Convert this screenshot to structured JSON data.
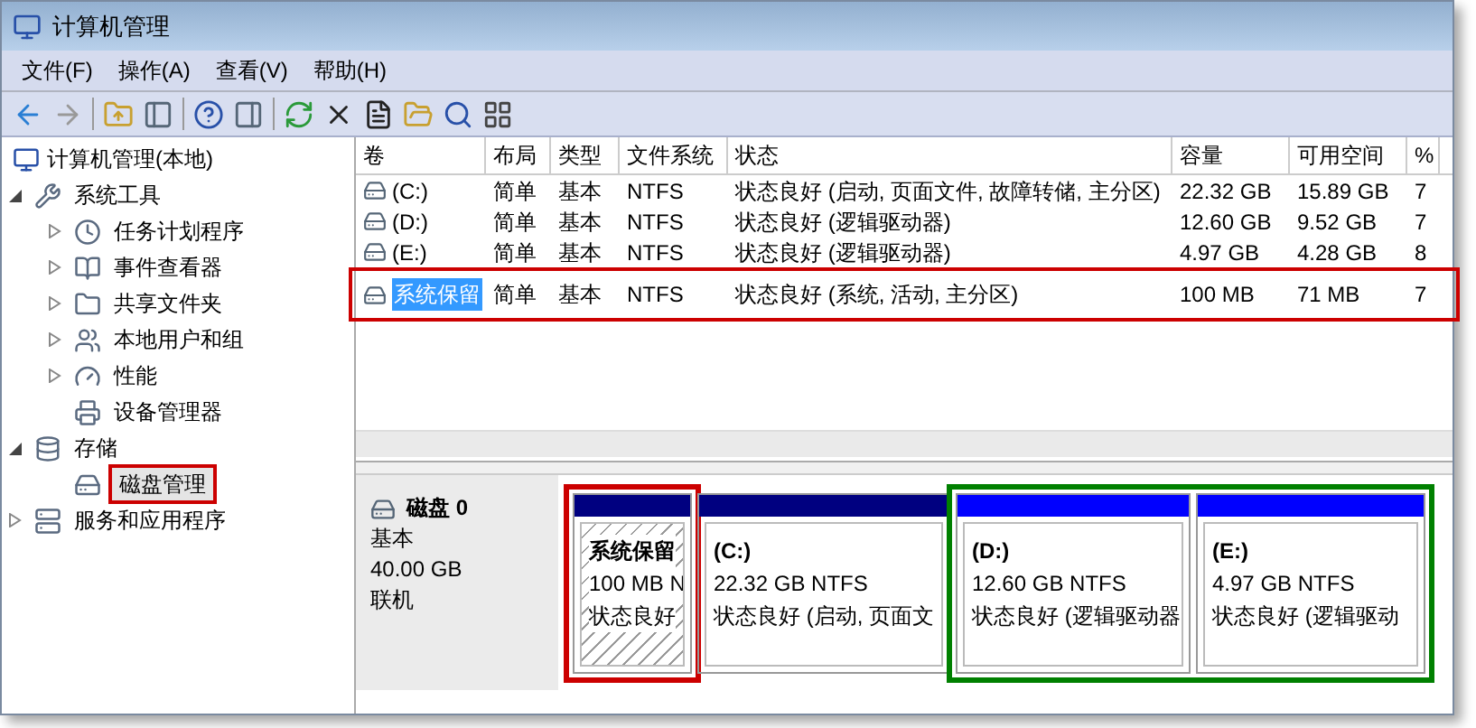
{
  "window": {
    "title": "计算机管理"
  },
  "menu": [
    "文件(F)",
    "操作(A)",
    "查看(V)",
    "帮助(H)"
  ],
  "tree": {
    "label": "计算机管理(本地)",
    "children": [
      {
        "label": "系统工具",
        "kind": "branch",
        "expanded": true,
        "selected": false,
        "children": [
          {
            "label": "任务计划程序",
            "kind": "branch",
            "expanded": false,
            "selected": false
          },
          {
            "label": "事件查看器",
            "kind": "branch",
            "expanded": false,
            "selected": false
          },
          {
            "label": "共享文件夹",
            "kind": "branch",
            "expanded": false,
            "selected": false
          },
          {
            "label": "本地用户和组",
            "kind": "branch",
            "expanded": false,
            "selected": false
          },
          {
            "label": "性能",
            "kind": "branch",
            "expanded": false,
            "selected": false
          },
          {
            "label": "设备管理器",
            "kind": "leaf",
            "selected": false
          }
        ]
      },
      {
        "label": "存储",
        "kind": "branch",
        "expanded": true,
        "selected": false,
        "children": [
          {
            "label": "磁盘管理",
            "kind": "leaf",
            "selected": true,
            "color": "#cc0000"
          }
        ]
      },
      {
        "label": "服务和应用程序",
        "kind": "branch",
        "expanded": false,
        "selected": false
      }
    ]
  },
  "table": {
    "columns": [
      "卷",
      "布局",
      "类型",
      "文件系统",
      "状态",
      "容量",
      "可用空间",
      "%"
    ],
    "rows": [
      {
        "selected": false,
        "cells": [
          "(C:)",
          "简单",
          "基本",
          "NTFS",
          "状态良好 (启动, 页面文件, 故障转储, 主分区)",
          "22.32 GB",
          "15.89 GB",
          "7"
        ]
      },
      {
        "selected": false,
        "cells": [
          "(D:)",
          "简单",
          "基本",
          "NTFS",
          "状态良好 (逻辑驱动器)",
          "12.60 GB",
          "9.52 GB",
          "7"
        ]
      },
      {
        "selected": false,
        "cells": [
          "(E:)",
          "简单",
          "基本",
          "NTFS",
          "状态良好 (逻辑驱动器)",
          "4.97 GB",
          "4.28 GB",
          "8"
        ]
      },
      {
        "selected": true,
        "color": "#cc0000",
        "cells": [
          "系统保留",
          "简单",
          "基本",
          "NTFS",
          "状态良好 (系统, 活动, 主分区)",
          "100 MB",
          "71 MB",
          "7"
        ]
      }
    ]
  },
  "disk": {
    "name": "磁盘 0",
    "type": "基本",
    "size": "40.00 GB",
    "status": "联机",
    "groups": [
      {
        "color": "#cc0000",
        "partitions": [
          {
            "kind": "primary",
            "selected": true,
            "name": "系统保留",
            "size": "100 MB N",
            "status": "状态良好"
          }
        ]
      },
      {
        "partitions": [
          {
            "kind": "primary",
            "selected": false,
            "name": "(C:)",
            "size": "22.32 GB NTFS",
            "status": "状态良好 (启动, 页面文"
          }
        ]
      },
      {
        "color": "#008000",
        "partitions": [
          {
            "kind": "logical",
            "selected": false,
            "name": "(D:)",
            "size": "12.60 GB NTFS",
            "status": "状态良好 (逻辑驱动器"
          },
          {
            "kind": "logical",
            "selected": false,
            "name": "(E:)",
            "size": "4.97 GB NTFS",
            "status": "状态良好 (逻辑驱动"
          }
        ]
      }
    ]
  }
}
